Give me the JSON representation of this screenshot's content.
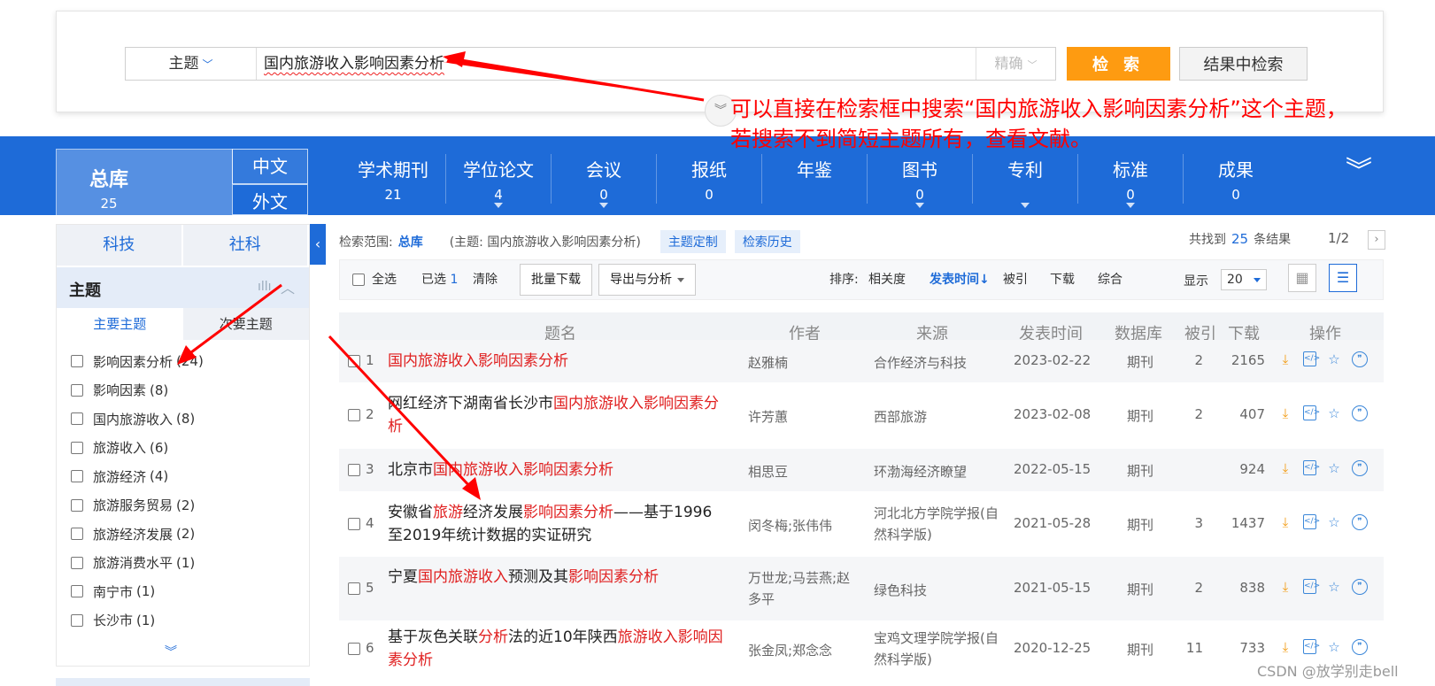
{
  "search": {
    "field": "主题",
    "query": "国内旅游收入影响因素分析",
    "match": "精确",
    "search_btn": "检 索",
    "within_btn": "结果中检索"
  },
  "annotation": {
    "line1": "可以直接在检索框中搜索“国内旅游收入影响因素分析”这个主题，",
    "line2": "若搜索不到简短主题所有，查看文献。",
    "color": "#ff0000"
  },
  "db_tabs": {
    "total": {
      "label": "总库",
      "count": "25"
    },
    "lang_zh": "中文",
    "lang_en": "外文",
    "categories": [
      {
        "label": "学术期刊",
        "count": "21"
      },
      {
        "label": "学位论文",
        "count": "4"
      },
      {
        "label": "会议",
        "count": "0"
      },
      {
        "label": "报纸",
        "count": "0"
      },
      {
        "label": "年鉴",
        "count": ""
      },
      {
        "label": "图书",
        "count": "0"
      },
      {
        "label": "专利",
        "count": ""
      },
      {
        "label": "标准",
        "count": "0"
      },
      {
        "label": "成果",
        "count": "0"
      }
    ]
  },
  "sidebar": {
    "tabs": [
      "科技",
      "社科"
    ],
    "facet_title": "主题",
    "subtabs": [
      "主要主题",
      "次要主题"
    ],
    "items": [
      {
        "label": "影响因素分析",
        "count": "(24)"
      },
      {
        "label": "影响因素",
        "count": "(8)"
      },
      {
        "label": "国内旅游收入",
        "count": "(8)"
      },
      {
        "label": "旅游收入",
        "count": "(6)"
      },
      {
        "label": "旅游经济",
        "count": "(4)"
      },
      {
        "label": "旅游服务贸易",
        "count": "(2)"
      },
      {
        "label": "旅游经济发展",
        "count": "(2)"
      },
      {
        "label": "旅游消费水平",
        "count": "(1)"
      },
      {
        "label": "南宁市",
        "count": "(1)"
      },
      {
        "label": "长沙市",
        "count": "(1)"
      }
    ]
  },
  "results_header": {
    "scope_label": "检索范围:",
    "scope_value": "总库",
    "query_desc": "(主题: 国内旅游收入影响因素分析)",
    "topic_custom": "主题定制",
    "history": "检索历史",
    "found_prefix": "共找到",
    "found_count": "25",
    "found_suffix": "条结果",
    "page": "1/2"
  },
  "toolbar": {
    "select_all": "全选",
    "selected_label": "已选",
    "selected_count": "1",
    "clear": "清除",
    "batch_download": "批量下载",
    "export": "导出与分析",
    "sort_label": "排序:",
    "sort_relevance": "相关度",
    "sort_date": "发表时间",
    "sort_cited": "被引",
    "sort_download": "下载",
    "sort_overall": "综合",
    "display_label": "显示",
    "page_size": "20"
  },
  "table": {
    "headers": [
      "题名",
      "作者",
      "来源",
      "发表时间",
      "数据库",
      "被引",
      "下载",
      "操作"
    ],
    "rows": [
      {
        "idx": "1",
        "title": [
          [
            "国内旅游收入影响因素分析",
            true
          ]
        ],
        "authors": "赵雅楠",
        "source": "合作经济与科技",
        "date": "2023-02-22",
        "db": "期刊",
        "cited": "2",
        "downloads": "2165"
      },
      {
        "idx": "2",
        "title": [
          [
            "网红经济下湖南省长沙市",
            false
          ],
          [
            "国内旅游收入影响因素分析",
            true
          ]
        ],
        "authors": "许芳蕙",
        "source": "西部旅游",
        "date": "2023-02-08",
        "db": "期刊",
        "cited": "2",
        "downloads": "407"
      },
      {
        "idx": "3",
        "title": [
          [
            "北京市",
            false
          ],
          [
            "国内旅游收入影响因素分析",
            true
          ]
        ],
        "authors": "相思豆",
        "source": "环渤海经济瞭望",
        "date": "2022-05-15",
        "db": "期刊",
        "cited": "",
        "downloads": "924"
      },
      {
        "idx": "4",
        "title": [
          [
            "安徽省",
            false
          ],
          [
            "旅游",
            true
          ],
          [
            "经济发展",
            false
          ],
          [
            "影响因素分析",
            true
          ],
          [
            "——基于1996至2019年统计数据的实证研究",
            false
          ]
        ],
        "authors": "闵冬梅;张伟伟",
        "source": "河北北方学院学报(自然科学版)",
        "date": "2021-05-28",
        "db": "期刊",
        "cited": "3",
        "downloads": "1437"
      },
      {
        "idx": "5",
        "title": [
          [
            "宁夏",
            false
          ],
          [
            "国内旅游收入",
            true
          ],
          [
            "预测及其",
            false
          ],
          [
            "影响因素分析",
            true
          ]
        ],
        "authors": "万世龙;马芸燕;赵多平",
        "source": "绿色科技",
        "date": "2021-05-15",
        "db": "期刊",
        "cited": "2",
        "downloads": "838"
      },
      {
        "idx": "6",
        "title": [
          [
            "基于灰色关联",
            false
          ],
          [
            "分析",
            true
          ],
          [
            "法的近10年陕西",
            false
          ],
          [
            "旅游收入影响因素分析",
            true
          ]
        ],
        "authors": "张金凤;郑念念",
        "source": "宝鸡文理学院学报(自然科学版)",
        "date": "2020-12-25",
        "db": "期刊",
        "cited": "11",
        "downloads": "733"
      }
    ]
  },
  "icons": {
    "download": "download-icon",
    "html": "html-read-icon",
    "favorite": "star-icon",
    "cite": "quote-icon"
  },
  "watermark": "CSDN @放学别走bell"
}
